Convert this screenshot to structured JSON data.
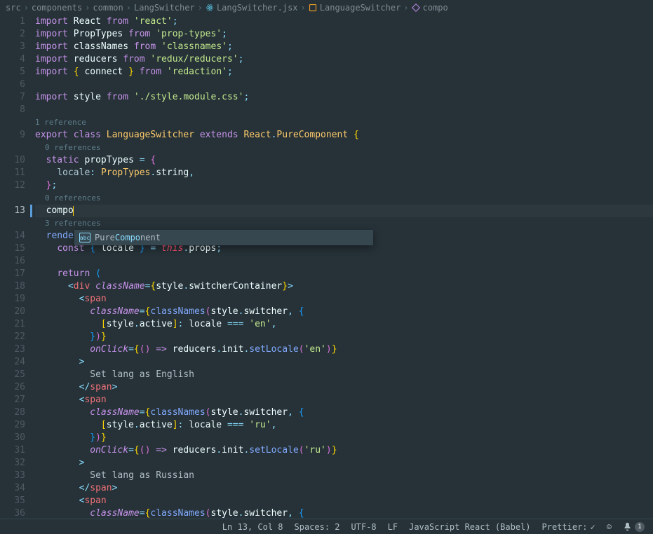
{
  "breadcrumb": [
    {
      "label": "src",
      "icon": null
    },
    {
      "label": "components",
      "icon": null
    },
    {
      "label": "common",
      "icon": null
    },
    {
      "label": "LangSwitcher",
      "icon": null
    },
    {
      "label": "LangSwitcher.jsx",
      "icon": "react"
    },
    {
      "label": "LanguageSwitcher",
      "icon": "class"
    },
    {
      "label": "compo",
      "icon": "method"
    }
  ],
  "codelens": {
    "ref1": "1 reference",
    "ref0a": "0 references",
    "ref0b": "0 references",
    "ref3": "3 references"
  },
  "lines": {
    "1": {
      "num": "1"
    },
    "2": {
      "num": "2"
    },
    "3": {
      "num": "3"
    },
    "4": {
      "num": "4"
    },
    "5": {
      "num": "5"
    },
    "6": {
      "num": "6"
    },
    "7": {
      "num": "7"
    },
    "8": {
      "num": "8"
    },
    "9": {
      "num": "9"
    },
    "10": {
      "num": "10"
    },
    "11": {
      "num": "11"
    },
    "12": {
      "num": "12"
    },
    "13": {
      "num": "13"
    },
    "14": {
      "num": "14"
    },
    "15": {
      "num": "15"
    },
    "16": {
      "num": "16"
    },
    "17": {
      "num": "17"
    },
    "18": {
      "num": "18"
    },
    "19": {
      "num": "19"
    },
    "20": {
      "num": "20"
    },
    "21": {
      "num": "21"
    },
    "22": {
      "num": "22"
    },
    "23": {
      "num": "23"
    },
    "24": {
      "num": "24"
    },
    "25": {
      "num": "25"
    },
    "26": {
      "num": "26"
    },
    "27": {
      "num": "27"
    },
    "28": {
      "num": "28"
    },
    "29": {
      "num": "29"
    },
    "30": {
      "num": "30"
    },
    "31": {
      "num": "31"
    },
    "32": {
      "num": "32"
    },
    "33": {
      "num": "33"
    },
    "34": {
      "num": "34"
    },
    "35": {
      "num": "35"
    },
    "36": {
      "num": "36"
    }
  },
  "tokens": {
    "import": "import",
    "export": "export",
    "class": "class",
    "extends": "extends",
    "static": "static",
    "from": "from",
    "const": "const",
    "return": "return",
    "React": "React",
    "PropTypes": "PropTypes",
    "classNames": "classNames",
    "reducers": "reducers",
    "connect": "connect",
    "style": "style",
    "LanguageSwitcher": "LanguageSwitcher",
    "PureComponent": "PureComponent",
    "propTypes": "propTypes",
    "locale": "locale",
    "string": "string",
    "compo": "compo",
    "render": "render",
    "this": "this",
    "props": "props",
    "div": "div",
    "span": "span",
    "className": "className",
    "switcherContainer": "switcherContainer",
    "switcher": "switcher",
    "active": "active",
    "onClick": "onClick",
    "init": "init",
    "setLocale": "setLocale",
    "str_react": "'react'",
    "str_proptypes": "'prop-types'",
    "str_classnames": "'classnames'",
    "str_redux": "'redux/reducers'",
    "str_redaction": "'redaction'",
    "str_style": "'./style.module.css'",
    "str_en": "'en'",
    "str_ru": "'ru'",
    "txt_english": "Set lang as English",
    "txt_russian": "Set lang as Russian"
  },
  "autocomplete": {
    "prefix": "Pure",
    "match": "Compo",
    "suffix": "nent",
    "icon": "abc"
  },
  "statusbar": {
    "position": "Ln 13, Col 8",
    "spaces": "Spaces: 2",
    "encoding": "UTF-8",
    "eol": "LF",
    "language": "JavaScript React (Babel)",
    "prettier": "Prettier:",
    "bell_count": "1"
  }
}
